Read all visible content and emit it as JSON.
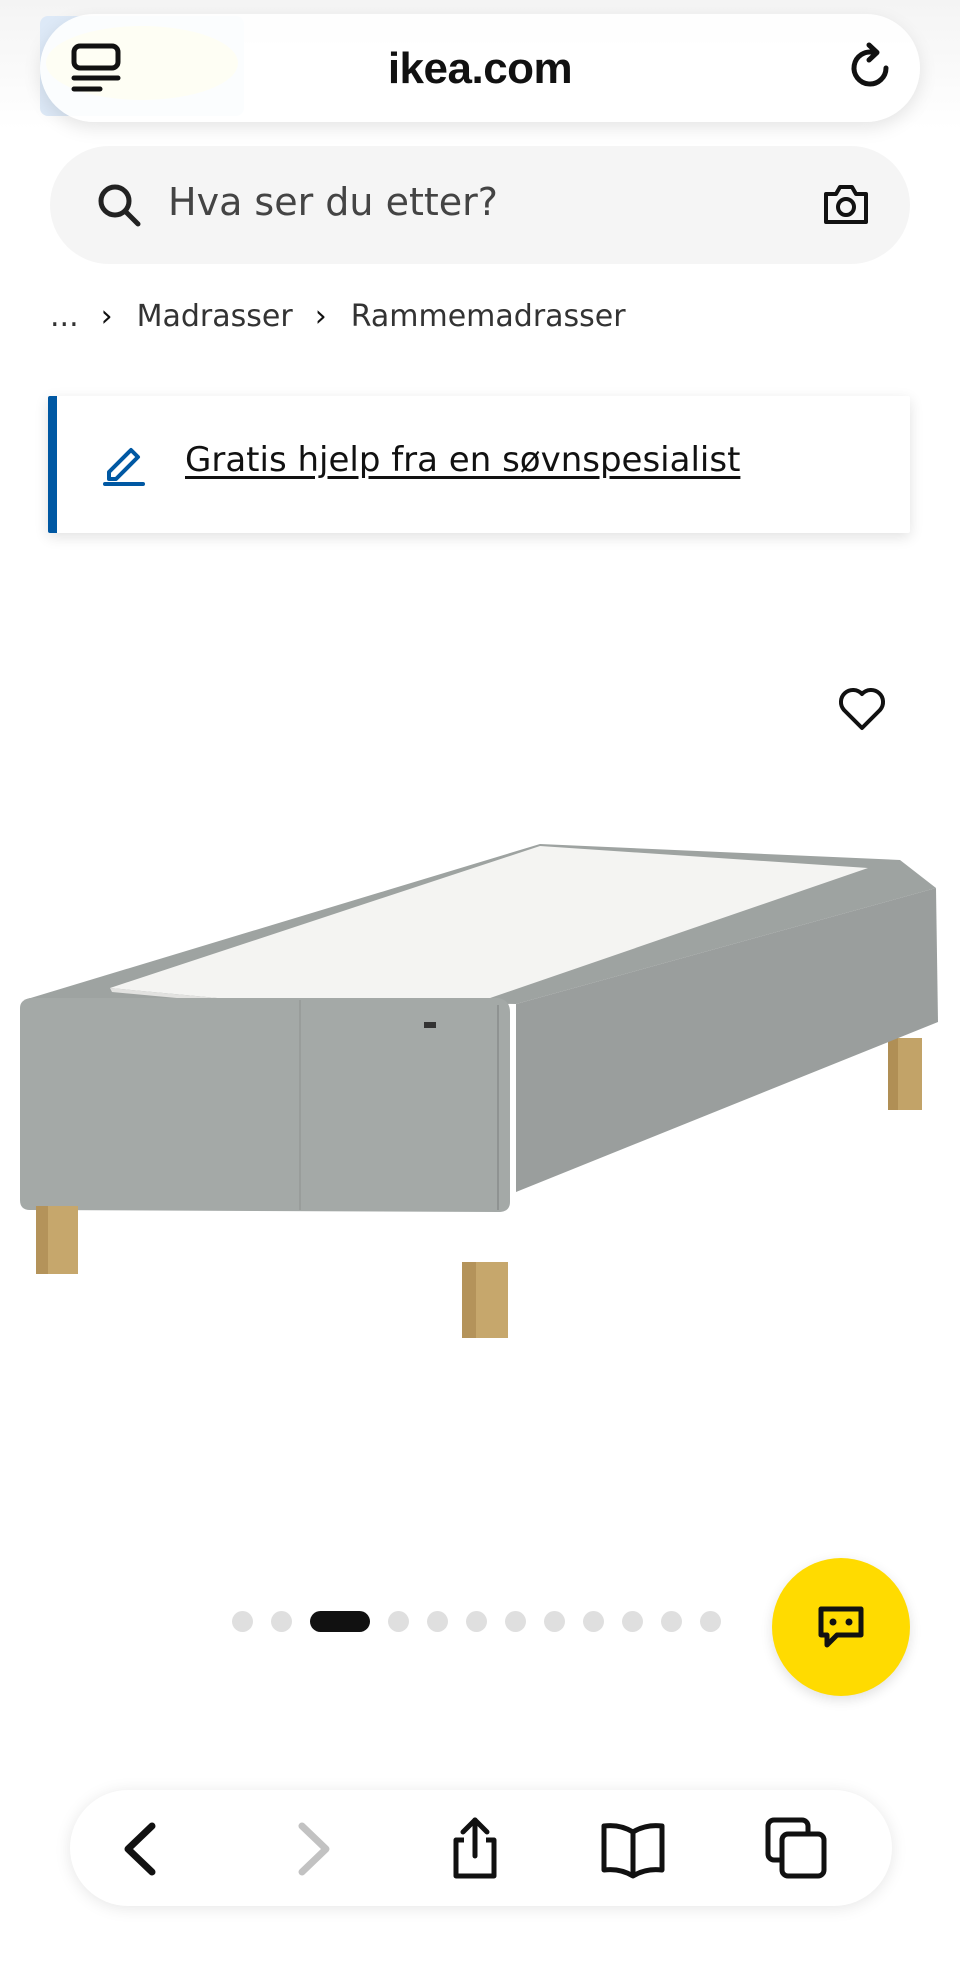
{
  "browser": {
    "url": "ikea.com",
    "icons": {
      "tabs": "tab-overview-icon",
      "reload": "reload-icon"
    }
  },
  "search": {
    "placeholder": "Hva ser du etter?",
    "icons": {
      "search": "magnifier-icon",
      "camera": "camera-icon"
    }
  },
  "breadcrumb": {
    "ellipsis": "...",
    "items": [
      "Madrasser",
      "Rammemadrasser"
    ]
  },
  "help_banner": {
    "text": "Gratis hjelp fra en søvnspesialist",
    "icon": "pencil-icon",
    "accent": "#0058a3"
  },
  "product_gallery": {
    "image": "single box-spring mattress base, light grey upholstery, wooden legs",
    "favorite_icon": "heart-outline-icon",
    "dots_total": 12,
    "active_index": 2
  },
  "chat": {
    "icon": "chat-bubble-icon",
    "color": "#ffdb00"
  },
  "toolbar": {
    "buttons": [
      "back-icon",
      "forward-icon",
      "share-icon",
      "bookmarks-icon",
      "tabs-icon"
    ]
  }
}
